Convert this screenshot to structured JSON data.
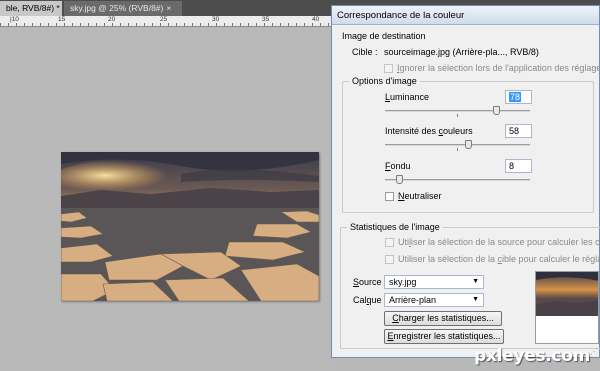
{
  "tabs": [
    {
      "label": "ble, RVB/8#) *",
      "close": "×"
    },
    {
      "label": "sky.jpg @ 25% (RVB/8#)",
      "close": "×"
    }
  ],
  "ruler": {
    "marks": [
      "|10",
      "15",
      "20",
      "25",
      "30",
      "35",
      "40"
    ]
  },
  "dialog": {
    "title": "Correspondance de la couleur",
    "destination": {
      "legend": "Image de destination",
      "target_label": "Cible :",
      "target_value": "sourceimage.jpg (Arrière-pla..., RVB/8)",
      "ignore_selection": {
        "prefix": "I",
        "rest": "gnorer la sélection lors de l'application des réglages",
        "checked": false
      }
    },
    "options": {
      "legend": "Options d'image",
      "luminance": {
        "label_u": "L",
        "label_rest": "uminance",
        "value": "78",
        "slider": 0.78
      },
      "intensity": {
        "label_pre": "Intensité des ",
        "label_u": "c",
        "label_rest": "ouleurs",
        "value": "58",
        "slider": 0.58
      },
      "fade": {
        "label_u": "F",
        "label_rest": "ondu",
        "value": "8",
        "slider": 0.08
      },
      "neutralize": {
        "label_u": "N",
        "label_rest": "eutraliser",
        "checked": false
      }
    },
    "stats": {
      "legend": "Statistiques de l'image",
      "use_source": {
        "pre": "Uti",
        "u": "l",
        "rest": "iser la sélection de la source pour calculer les couleurs",
        "checked": false
      },
      "use_target": {
        "pre": "Utiliser la sélection de la ",
        "u": "c",
        "rest": "ible pour calculer le réglage",
        "checked": false
      },
      "source": {
        "label_u": "S",
        "label_rest": "ource :",
        "value": "sky.jpg"
      },
      "layer": {
        "label_pre": "Cal",
        "label_u": "q",
        "label_rest": "ue :",
        "value": "Arrière-plan"
      },
      "load_button": {
        "u": "C",
        "rest": "harger les statistiques..."
      },
      "save_button": {
        "u": "E",
        "rest": "nregistrer les statistiques..."
      }
    }
  },
  "watermark": "pxleyes.com",
  "colors": {
    "title_bg": "#cfdcec",
    "selection": "#3399ff",
    "dialog_bg": "#f0f0f0"
  }
}
